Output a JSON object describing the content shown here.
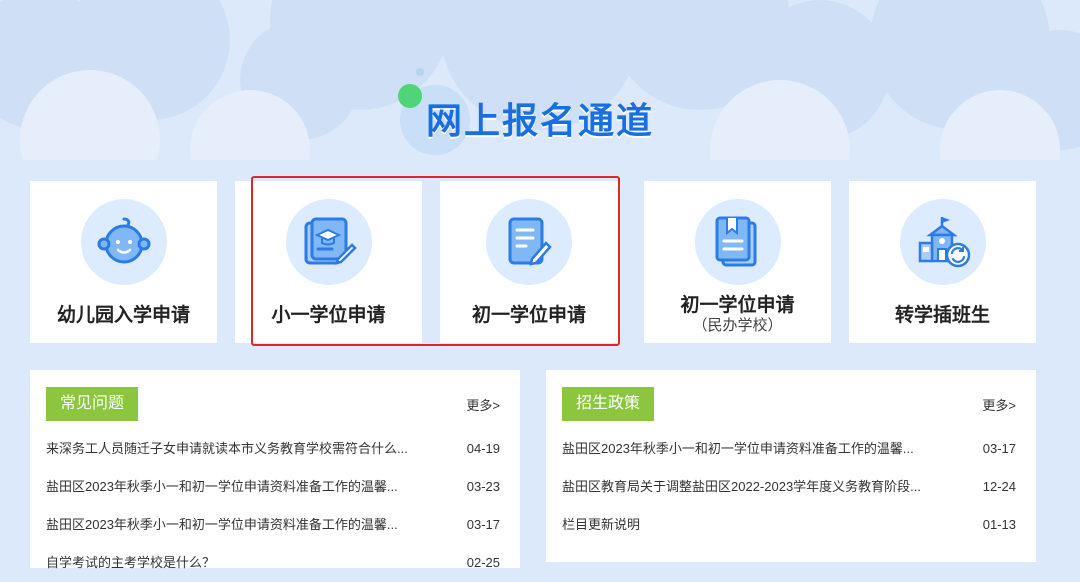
{
  "hero": {
    "title": "网上报名通道"
  },
  "cards": [
    {
      "label": "幼儿园入学申请",
      "icon": "baby-face-icon"
    },
    {
      "label": "小一学位申请",
      "icon": "graduation-document-icon"
    },
    {
      "label": "初一学位申请",
      "icon": "edit-document-icon"
    },
    {
      "label": "初一学位申请",
      "sub": "（民办学校）",
      "icon": "bookmark-document-icon"
    },
    {
      "label": "转学插班生",
      "icon": "school-transfer-icon"
    }
  ],
  "faq": {
    "tag": "常见问题",
    "more": "更多>",
    "items": [
      {
        "title": "来深务工人员随迁子女申请就读本市义务教育学校需符合什么...",
        "date": "04-19"
      },
      {
        "title": "盐田区2023年秋季小一和初一学位申请资料准备工作的温馨...",
        "date": "03-23"
      },
      {
        "title": "盐田区2023年秋季小一和初一学位申请资料准备工作的温馨...",
        "date": "03-17"
      },
      {
        "title": "自学考试的主考学校是什么？",
        "date": "02-25"
      }
    ]
  },
  "policy": {
    "tag": "招生政策",
    "more": "更多>",
    "items": [
      {
        "title": "盐田区2023年秋季小一和初一学位申请资料准备工作的温馨...",
        "date": "03-17"
      },
      {
        "title": "盐田区教育局关于调整盐田区2022-2023学年度义务教育阶段...",
        "date": "12-24"
      },
      {
        "title": "栏目更新说明",
        "date": "01-13"
      }
    ]
  },
  "colors": {
    "accent": "#1a6fe0",
    "tag_green": "#8cc63e",
    "highlight_red": "#e0262a",
    "background": "#dce9fa"
  }
}
